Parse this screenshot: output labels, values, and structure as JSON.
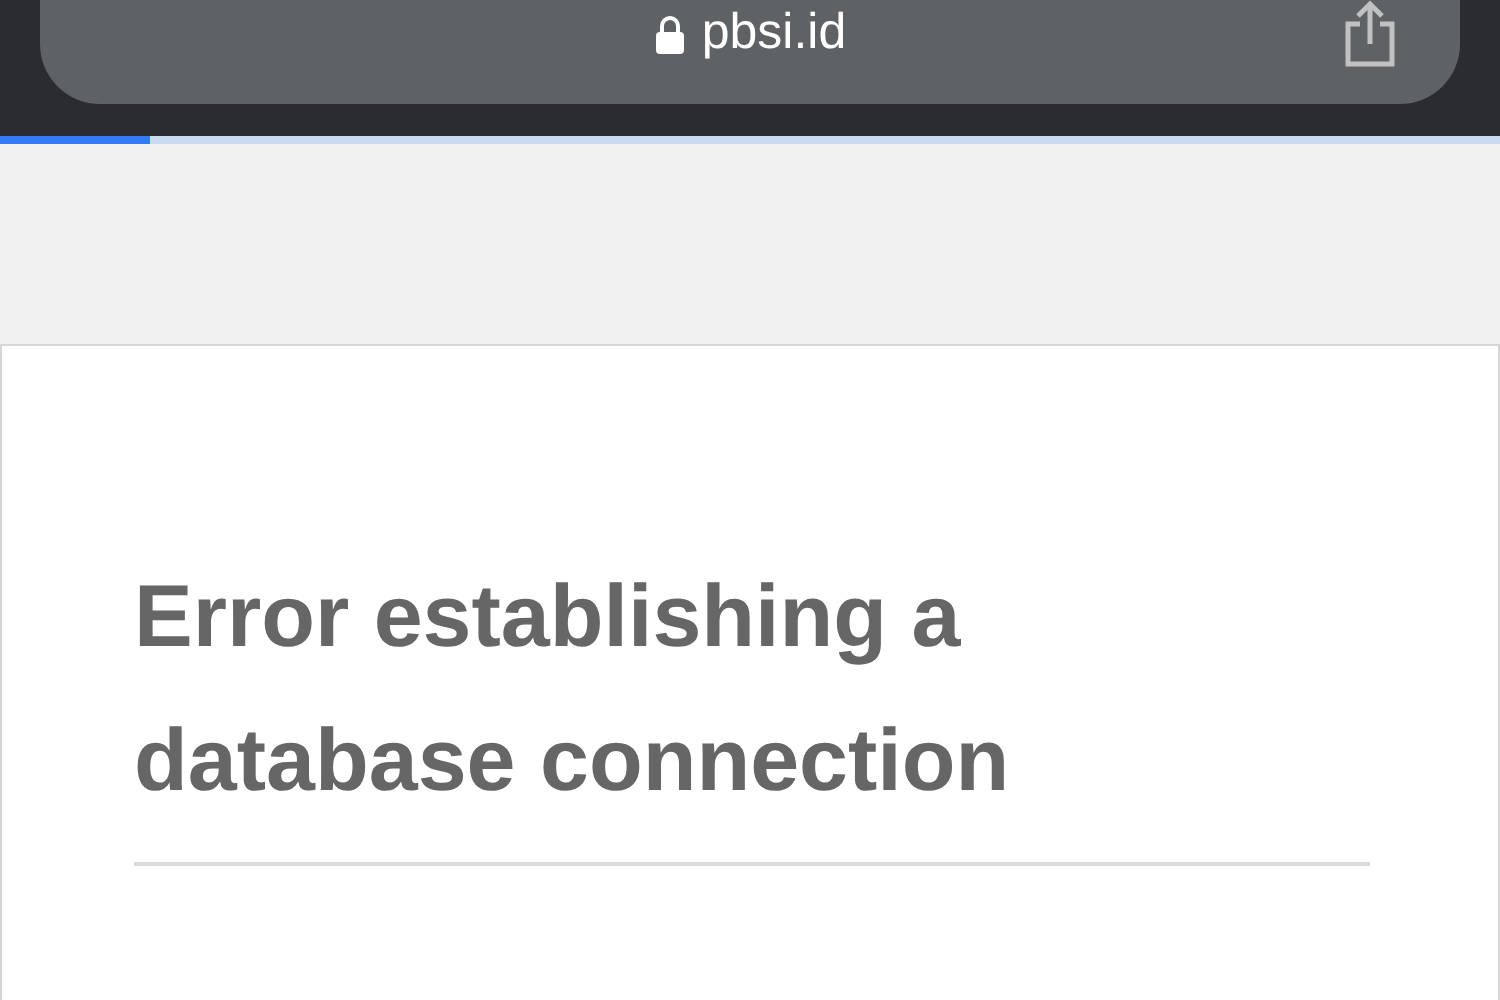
{
  "address_bar": {
    "url": "pbsi.id"
  },
  "progress": {
    "level": 0.1
  },
  "page": {
    "heading": "Error establishing a database connection"
  }
}
